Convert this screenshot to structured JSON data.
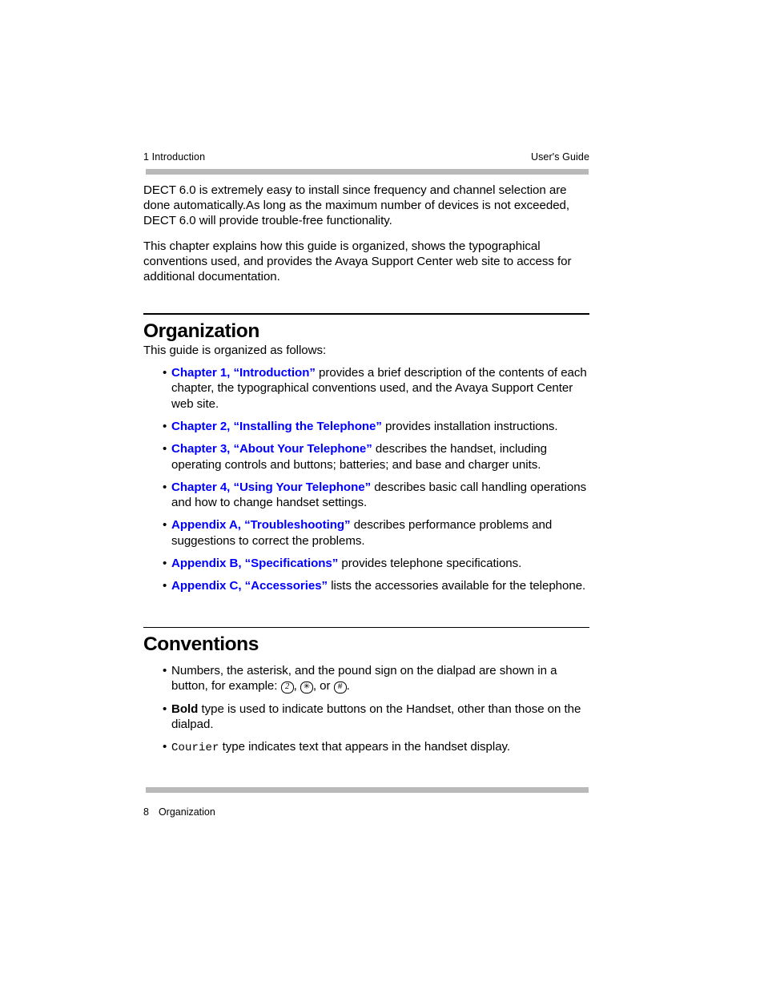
{
  "header": {
    "left": "1 Introduction",
    "right": "User's Guide"
  },
  "intro": {
    "paragraph_1": "DECT 6.0 is extremely easy to install since frequency and channel selection are done automatically.As long as the maximum number of devices is not exceeded, DECT 6.0 will provide trouble-free functionality.",
    "paragraph_2": "This chapter explains how this guide is organized, shows the typographical conventions used, and provides the Avaya Support Center web site to access for additional documentation."
  },
  "organization": {
    "title": "Organization",
    "intro": "This guide is organized as follows:",
    "bullet_mark": "•",
    "items": [
      {
        "link": "Chapter 1, “Introduction”",
        "text": " provides a brief description of the contents of each chapter, the typographical conventions used, and the Avaya Support Center web site."
      },
      {
        "link": "Chapter 2, “Installing the Telephone”",
        "text": " provides installation instructions."
      },
      {
        "link": "Chapter 3, “About Your Telephone”",
        "text": " describes the handset, including operating controls and buttons; batteries; and base and charger units."
      },
      {
        "link": "Chapter 4, “Using Your Telephone”",
        "text": " describes basic call handling operations and how to change handset settings."
      },
      {
        "link": "Appendix A, “Troubleshooting”",
        "text": " describes performance problems and suggestions to correct the problems."
      },
      {
        "link": "Appendix B, “Specifications”",
        "text": " provides telephone specifications."
      },
      {
        "link": "Appendix C, “Accessories”",
        "text": " lists the accessories available for the telephone."
      }
    ]
  },
  "conventions": {
    "title": "Conventions",
    "bullet_mark": "•",
    "item_1": {
      "text_before": "Numbers, the asterisk, and the pound sign on the dialpad are shown in a button, for example: ",
      "key_2": "2",
      "sep_1": ", ",
      "key_star": "✳",
      "sep_2": ", or ",
      "key_pound": "#",
      "text_after": "."
    },
    "item_2": {
      "bold": "Bold",
      "text": " type is used to indicate buttons on the Handset, other than those on the dialpad."
    },
    "item_3": {
      "mono": "Courier",
      "text": " type indicates text that appears in the handset display."
    }
  },
  "footer": {
    "page_number": "8",
    "section_label": "Organization"
  },
  "colors": {
    "link_blue": "#0000ff",
    "rule_gray": "#b9b9b9",
    "text_black": "#000000"
  }
}
